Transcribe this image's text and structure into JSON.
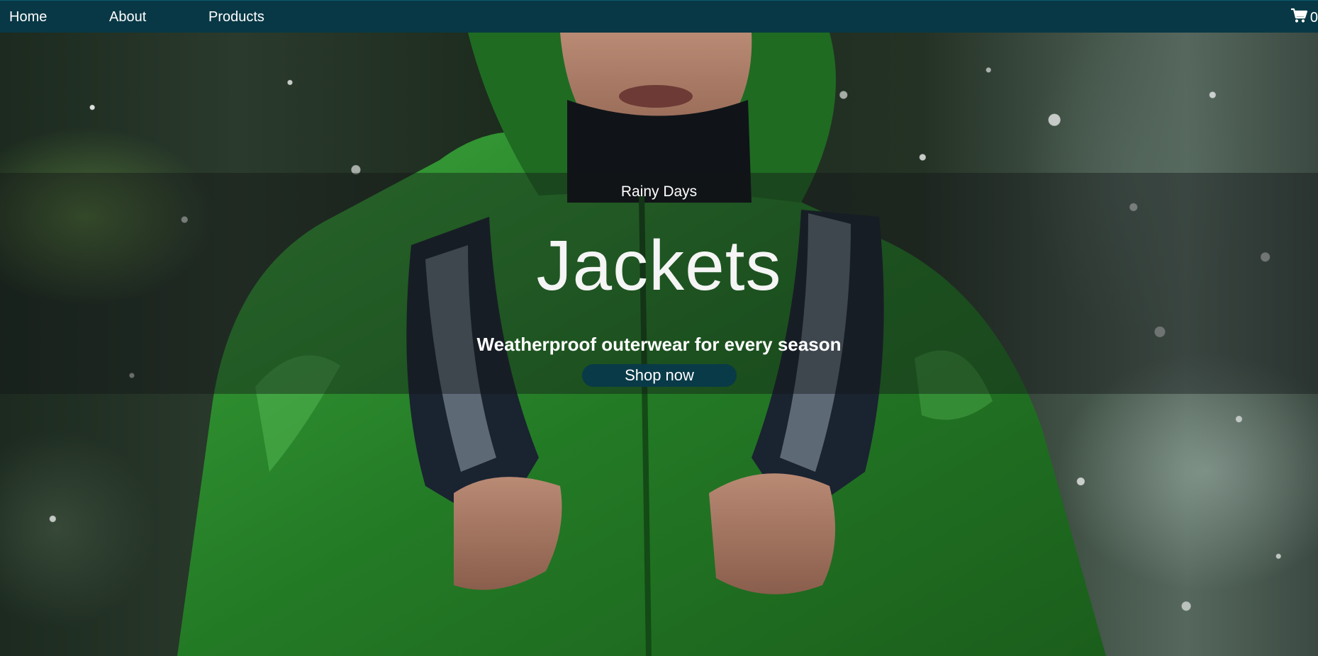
{
  "nav": {
    "items": [
      {
        "label": "Home"
      },
      {
        "label": "About"
      },
      {
        "label": "Products"
      }
    ],
    "cart": {
      "icon": "cart-icon",
      "count": "0"
    }
  },
  "hero": {
    "eyebrow": "Rainy Days",
    "headline": "Jackets",
    "tagline": "Weatherproof outerwear for every season",
    "cta_label": "Shop now"
  },
  "colors": {
    "nav_bg": "#083845",
    "cta_bg": "#093a48",
    "jacket_green": "#2e8b2e"
  }
}
